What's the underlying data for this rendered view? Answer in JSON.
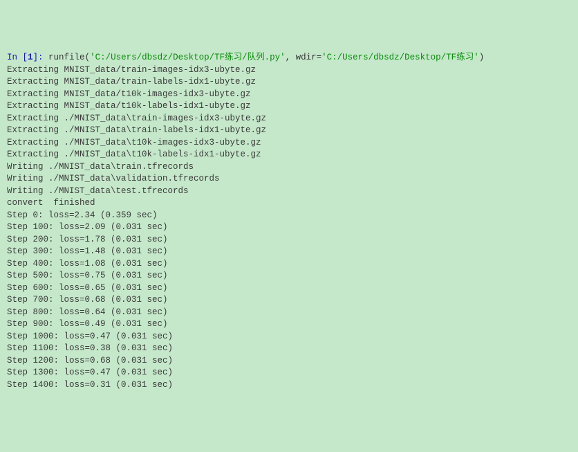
{
  "prompt": {
    "in_label": "In [",
    "number": "1",
    "close_label": "]: ",
    "func": "runfile",
    "open_paren": "(",
    "arg1": "'C:/Users/dbsdz/Desktop/TF练习/队列.py'",
    "comma": ", ",
    "kwarg_name": "wdir=",
    "arg2": "'C:/Users/dbsdz/Desktop/TF练习'",
    "close_paren": ")"
  },
  "output_lines": [
    "Extracting MNIST_data/train-images-idx3-ubyte.gz",
    "Extracting MNIST_data/train-labels-idx1-ubyte.gz",
    "Extracting MNIST_data/t10k-images-idx3-ubyte.gz",
    "Extracting MNIST_data/t10k-labels-idx1-ubyte.gz",
    "Extracting ./MNIST_data\\train-images-idx3-ubyte.gz",
    "Extracting ./MNIST_data\\train-labels-idx1-ubyte.gz",
    "Extracting ./MNIST_data\\t10k-images-idx3-ubyte.gz",
    "Extracting ./MNIST_data\\t10k-labels-idx1-ubyte.gz",
    "Writing ./MNIST_data\\train.tfrecords",
    "Writing ./MNIST_data\\validation.tfrecords",
    "Writing ./MNIST_data\\test.tfrecords",
    "convert  finished",
    "Step 0: loss=2.34 (0.359 sec)",
    "Step 100: loss=2.09 (0.031 sec)",
    "Step 200: loss=1.78 (0.031 sec)",
    "Step 300: loss=1.48 (0.031 sec)",
    "Step 400: loss=1.08 (0.031 sec)",
    "Step 500: loss=0.75 (0.031 sec)",
    "Step 600: loss=0.65 (0.031 sec)",
    "Step 700: loss=0.68 (0.031 sec)",
    "Step 800: loss=0.64 (0.031 sec)",
    "Step 900: loss=0.49 (0.031 sec)",
    "Step 1000: loss=0.47 (0.031 sec)",
    "Step 1100: loss=0.38 (0.031 sec)",
    "Step 1200: loss=0.68 (0.031 sec)",
    "Step 1300: loss=0.47 (0.031 sec)",
    "Step 1400: loss=0.31 (0.031 sec)"
  ]
}
